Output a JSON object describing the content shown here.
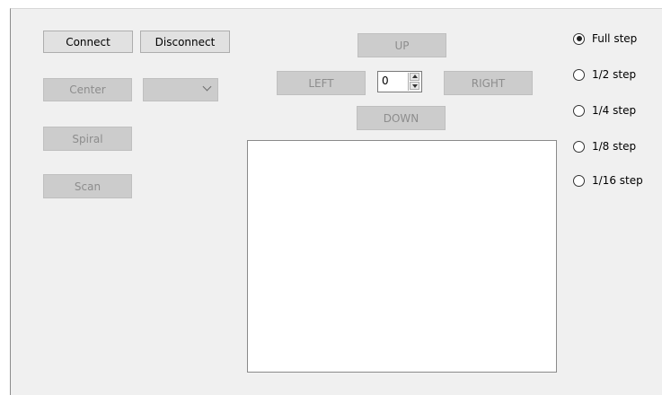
{
  "connection": {
    "connect_label": "Connect",
    "disconnect_label": "Disconnect"
  },
  "actions": {
    "center_label": "Center",
    "spiral_label": "Spiral",
    "scan_label": "Scan",
    "dropdown_value": ""
  },
  "jog": {
    "up_label": "UP",
    "down_label": "DOWN",
    "left_label": "LEFT",
    "right_label": "RIGHT",
    "step_value": "0"
  },
  "step_modes": {
    "selected": "Full step",
    "options": [
      "Full step",
      "1/2 step",
      "1/4 step",
      "1/8 step",
      "1/16 step"
    ]
  },
  "colors": {
    "window_bg": "#f0f0f0",
    "enabled_button": "#e1e1e1",
    "disabled_button": "#cccccc",
    "disabled_text": "#8d8d8d"
  }
}
